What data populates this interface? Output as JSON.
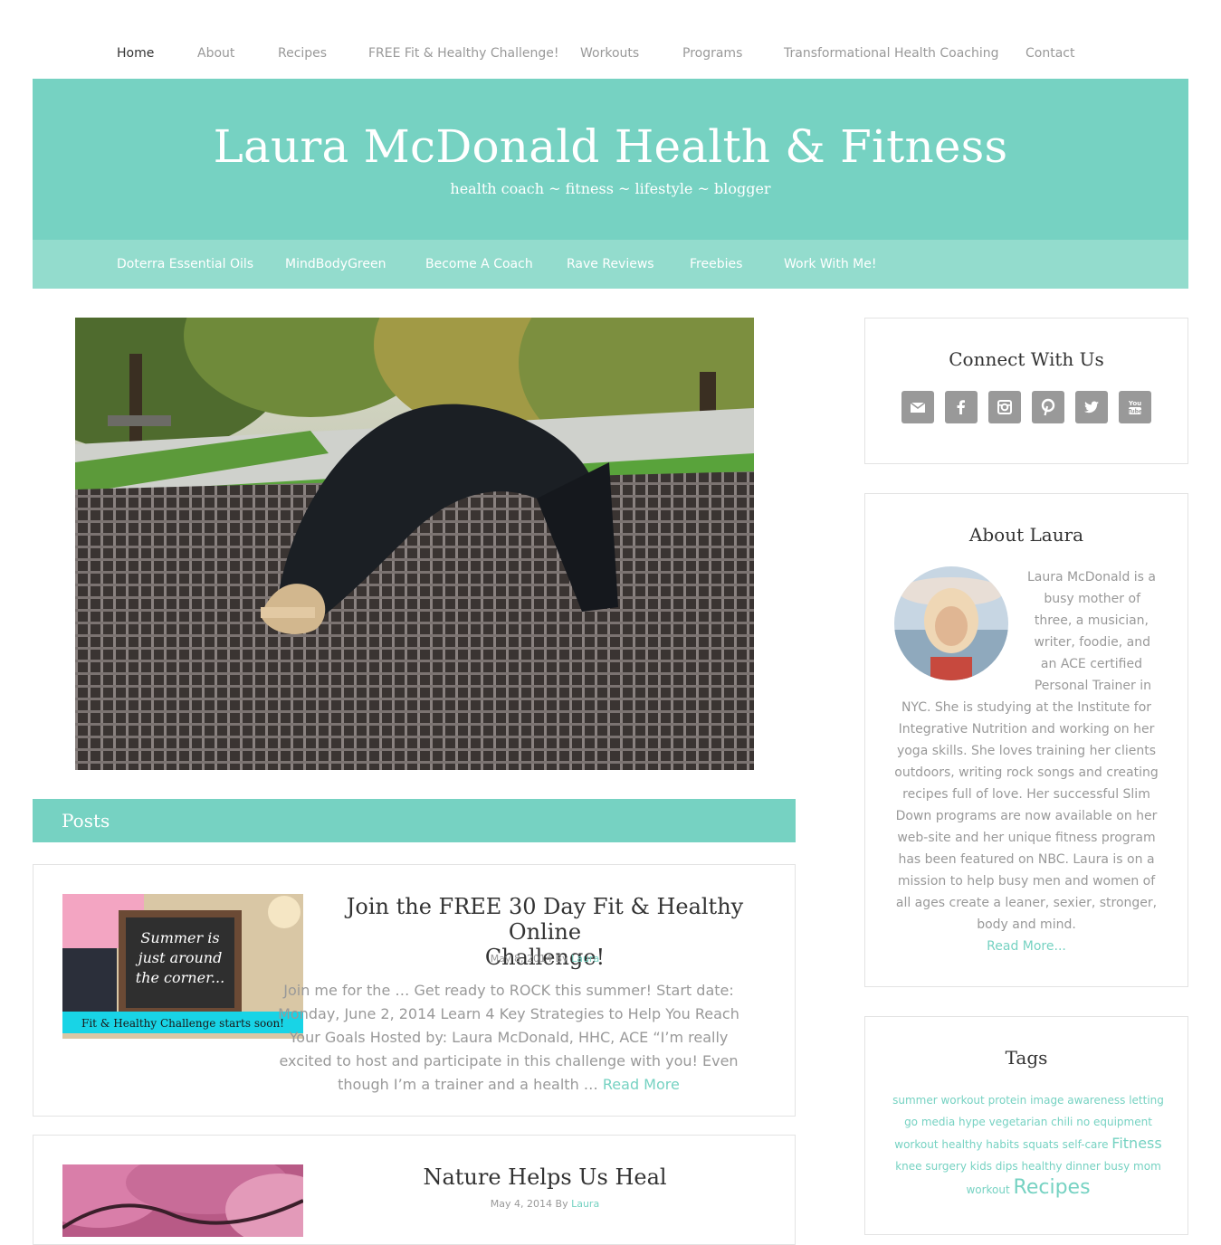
{
  "top_nav": [
    {
      "label": "Home",
      "active": true
    },
    {
      "label": "About"
    },
    {
      "label": "Recipes"
    },
    {
      "label": "FREE Fit & Healthy Challenge!"
    },
    {
      "label": "Workouts"
    },
    {
      "label": "Programs"
    },
    {
      "label": "Transformational Health Coaching"
    },
    {
      "label": "Contact"
    }
  ],
  "header": {
    "title": "Laura McDonald Health & Fitness",
    "description": "health coach ~ fitness ~ lifestyle ~ blogger"
  },
  "sub_nav": [
    {
      "label": "Doterra Essential Oils"
    },
    {
      "label": "MindBodyGreen"
    },
    {
      "label": "Become A Coach"
    },
    {
      "label": "Rave Reviews"
    },
    {
      "label": "Freebies"
    },
    {
      "label": "Work With Me!"
    }
  ],
  "posts_heading": "Posts",
  "posts": [
    {
      "title_lines": [
        "Join the FREE 30 Day Fit & Healthy Online",
        "Challenge!"
      ],
      "date": "May 8, 2014",
      "by": "By",
      "author": "Laura",
      "thumb_text": [
        "Summer is",
        "just around",
        "the corner..."
      ],
      "thumb_banner": "Fit & Healthy Challenge starts soon!",
      "excerpt_lines": [
        "Join me for the …   Get ready to ROCK this summer! Start date:",
        "Monday, June 2, 2014  Learn 4 Key Strategies to Help You Reach",
        "Your Goals Hosted by: Laura McDonald, HHC, ACE “I’m really",
        "excited to host and participate in this challenge with you! Even",
        "though I’m a trainer and a health …"
      ],
      "read_more": "Read More"
    },
    {
      "title_lines": [
        "Nature Helps Us Heal"
      ],
      "date": "May 4, 2014",
      "by": "By",
      "author": "Laura"
    }
  ],
  "sidebar": {
    "connect": {
      "title": "Connect With Us",
      "icons": [
        "email-icon",
        "facebook-icon",
        "instagram-icon",
        "pinterest-icon",
        "twitter-icon",
        "youtube-icon"
      ]
    },
    "about": {
      "title": "About Laura",
      "lines": [
        "Laura McDonald is a",
        "busy mother of",
        "three, a musician,",
        "writer, foodie, and",
        "an ACE certified",
        "Personal Trainer in",
        "NYC. She is studying at the Institute for",
        "Integrative Nutrition and working on her",
        "yoga skills. She loves training her clients",
        "outdoors, writing rock songs and creating",
        "recipes full of love. Her successful Slim",
        "Down programs are now available on her",
        "web-site and her unique fitness program",
        "has been featured on NBC. Laura is on a",
        "mission to help busy men and women of",
        "all ages create a leaner, sexier, stronger,",
        "body and mind."
      ],
      "read_more": "Read More..."
    },
    "tags": {
      "title": "Tags",
      "items": [
        {
          "label": "summer workout",
          "size": 12
        },
        {
          "label": "protein",
          "size": 12
        },
        {
          "label": "image",
          "size": 12
        },
        {
          "label": "awareness",
          "size": 12
        },
        {
          "label": "letting go",
          "size": 12
        },
        {
          "label": "media hype",
          "size": 12
        },
        {
          "label": "vegetarian chili",
          "size": 12
        },
        {
          "label": "no equipment workout",
          "size": 12
        },
        {
          "label": "healthy habits",
          "size": 12
        },
        {
          "label": "squats",
          "size": 12
        },
        {
          "label": "self-care",
          "size": 12
        },
        {
          "label": "Fitness",
          "size": 16
        },
        {
          "label": "knee surgery",
          "size": 12
        },
        {
          "label": "kids",
          "size": 12
        },
        {
          "label": "dips",
          "size": 12
        },
        {
          "label": "healthy dinner",
          "size": 12
        },
        {
          "label": "busy mom workout",
          "size": 12
        },
        {
          "label": "Recipes",
          "size": 22
        }
      ]
    }
  },
  "colors": {
    "accent": "#76d2c2",
    "subnav": "#93dccd",
    "icon_bg": "#999999"
  }
}
